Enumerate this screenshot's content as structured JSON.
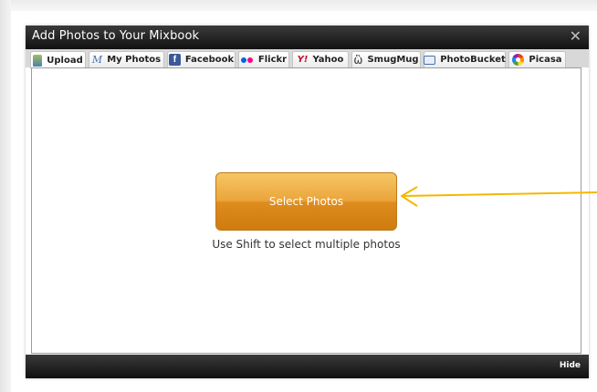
{
  "dialog": {
    "title": "Add Photos to Your Mixbook",
    "close_label": "✕",
    "tabs": [
      {
        "label": "Upload",
        "icon": "upload-icon",
        "active": true
      },
      {
        "label": "My Photos",
        "icon": "mixbook-icon",
        "icon_text": "M"
      },
      {
        "label": "Facebook",
        "icon": "facebook-icon",
        "icon_text": "f"
      },
      {
        "label": "Flickr",
        "icon": "flickr-icon"
      },
      {
        "label": "Yahoo",
        "icon": "yahoo-icon",
        "icon_text": "Y!"
      },
      {
        "label": "SmugMug",
        "icon": "smugmug-icon",
        "icon_text": "ὣ"
      },
      {
        "label": "PhotoBucket",
        "icon": "photobucket-icon"
      },
      {
        "label": "Picasa",
        "icon": "picasa-icon"
      }
    ],
    "select_button": "Select Photos",
    "hint": "Use Shift to select multiple photos",
    "hide_label": "Hide"
  },
  "colors": {
    "button_top": "#f6c664",
    "button_bottom": "#cf7b10",
    "arrow": "#f5b800",
    "titlebar": "#1a1a1a"
  }
}
